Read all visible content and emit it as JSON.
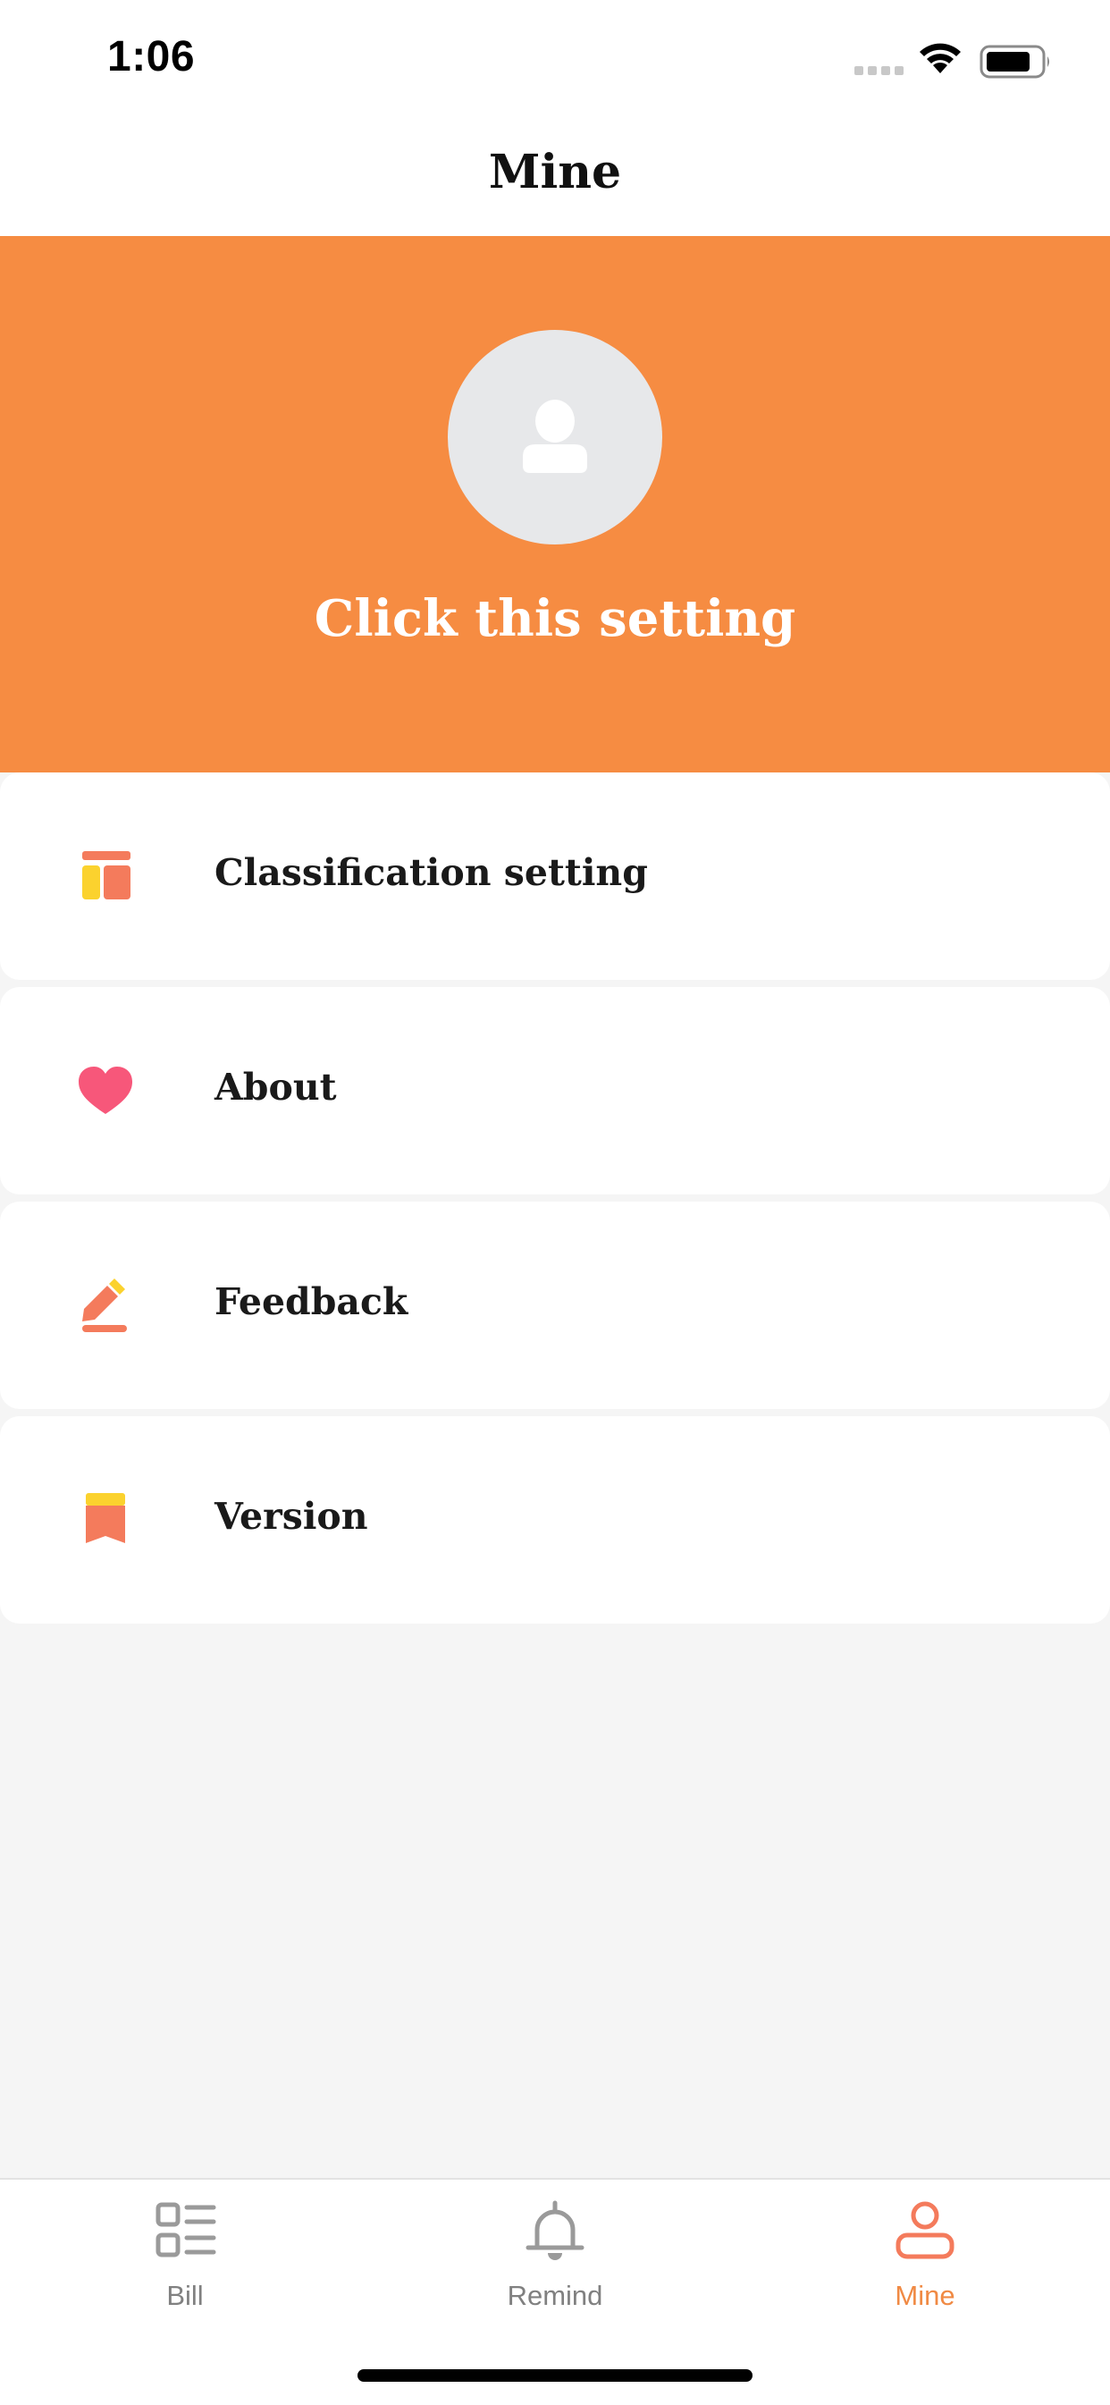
{
  "status_bar": {
    "time": "1:06"
  },
  "nav": {
    "title": "Mine"
  },
  "profile": {
    "prompt": "Click this setting",
    "avatar_icon": "user-icon"
  },
  "menu": {
    "items": [
      {
        "label": "Classification setting",
        "icon": "category-icon"
      },
      {
        "label": "About",
        "icon": "heart-icon"
      },
      {
        "label": "Feedback",
        "icon": "edit-icon"
      },
      {
        "label": "Version",
        "icon": "bookmark-icon"
      }
    ]
  },
  "tabs": [
    {
      "label": "Bill",
      "icon": "bill-list-icon",
      "active": false
    },
    {
      "label": "Remind",
      "icon": "bell-icon",
      "active": false
    },
    {
      "label": "Mine",
      "icon": "person-icon",
      "active": true
    }
  ],
  "colors": {
    "accent": "#f68c42",
    "active_tab": "#f08a44",
    "inactive_tab": "#9a9a9a",
    "icon_coral": "#f47b5c",
    "icon_yellow": "#fbd22e",
    "icon_pink": "#f7577a"
  }
}
